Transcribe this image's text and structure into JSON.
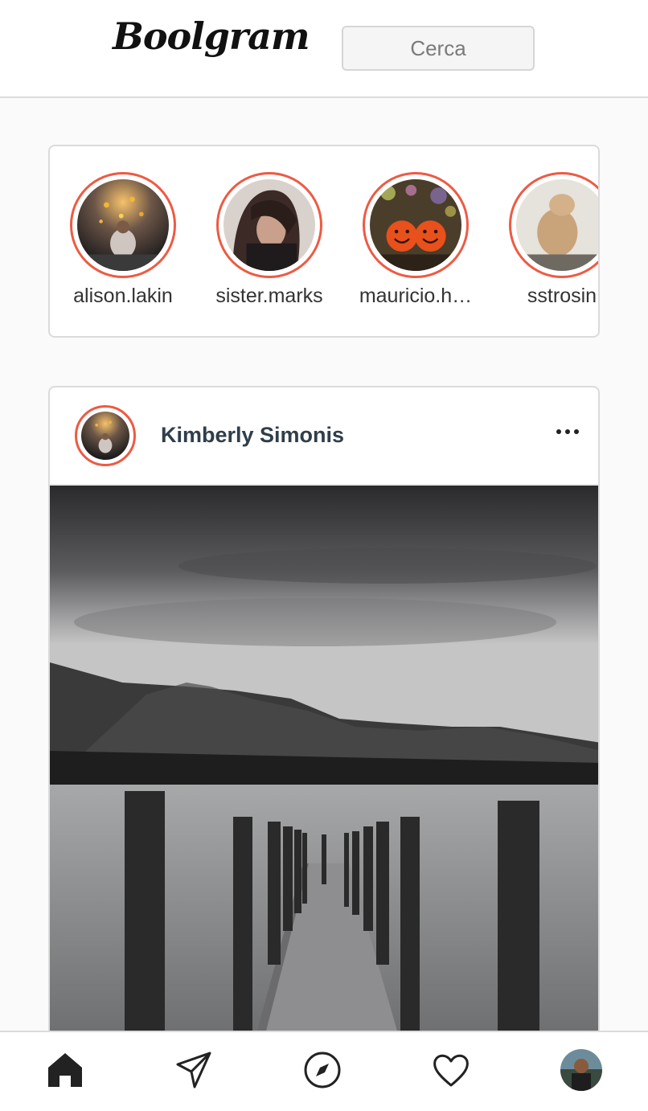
{
  "header": {
    "logo_text": "Boolgram",
    "search_placeholder": "Cerca"
  },
  "stories": [
    {
      "username": "alison.lakin"
    },
    {
      "username": "sister.marks"
    },
    {
      "username": "mauricio.h…"
    },
    {
      "username": "sstrosin"
    }
  ],
  "post": {
    "username": "Kimberly Simonis"
  },
  "nav": {
    "items": [
      "home-icon",
      "send-icon",
      "explore-icon",
      "heart-icon",
      "profile-avatar"
    ]
  },
  "colors": {
    "accent_ring": "#ee5a43",
    "background": "#fafafa",
    "border": "#dbdbdb"
  }
}
